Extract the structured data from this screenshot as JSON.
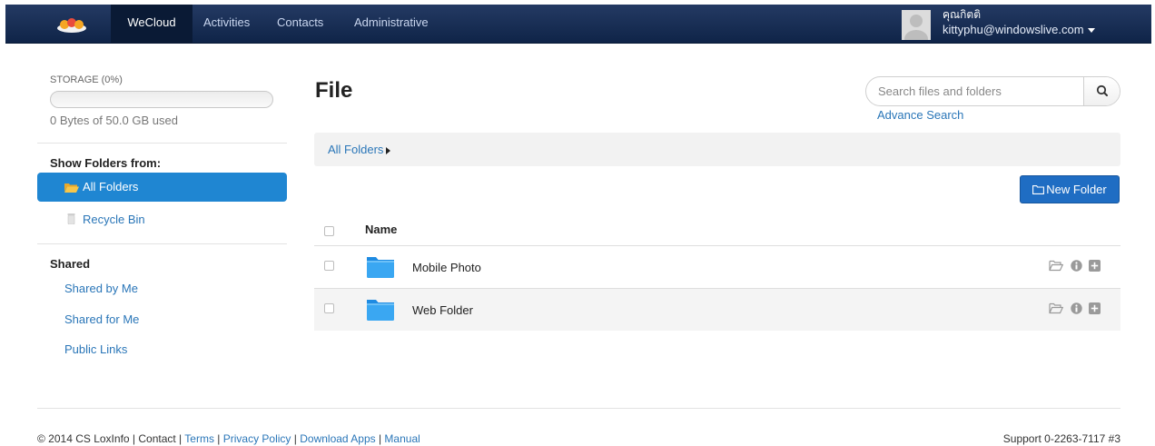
{
  "nav": {
    "brand": "WeCloud",
    "items": [
      {
        "label": "Activities"
      },
      {
        "label": "Contacts"
      },
      {
        "label": "Administrative"
      }
    ],
    "user": {
      "name": "คุณกิตติ",
      "email": "kittyphu@windowslive.com"
    }
  },
  "sidebar": {
    "storage_title": "STORAGE (0%)",
    "storage_percent": 0,
    "storage_used": "0 Bytes of 50.0 GB used",
    "show_folders_label": "Show Folders from:",
    "folders": [
      {
        "label": "All Folders",
        "active": true
      },
      {
        "label": "Recycle Bin",
        "active": false
      }
    ],
    "shared_label": "Shared",
    "shared": [
      {
        "label": "Shared by Me"
      },
      {
        "label": "Shared for Me"
      },
      {
        "label": "Public Links"
      }
    ]
  },
  "main": {
    "title": "File",
    "search_placeholder": "Search files and folders",
    "advance_search": "Advance Search",
    "breadcrumb": "All Folders",
    "new_folder": "New Folder",
    "column_name": "Name",
    "files": [
      {
        "name": "Mobile Photo"
      },
      {
        "name": "Web Folder"
      }
    ]
  },
  "footer": {
    "copyright": "© 2014 CS LoxInfo | Contact | ",
    "links": [
      "Terms",
      "Privacy Policy",
      "Download Apps",
      "Manual"
    ],
    "support": "Support 0-2263-7117 #3"
  },
  "colors": {
    "navbar": "#1a3058",
    "accent": "#1f86d2",
    "link": "#2a76b8",
    "button": "#1f6dc3"
  }
}
